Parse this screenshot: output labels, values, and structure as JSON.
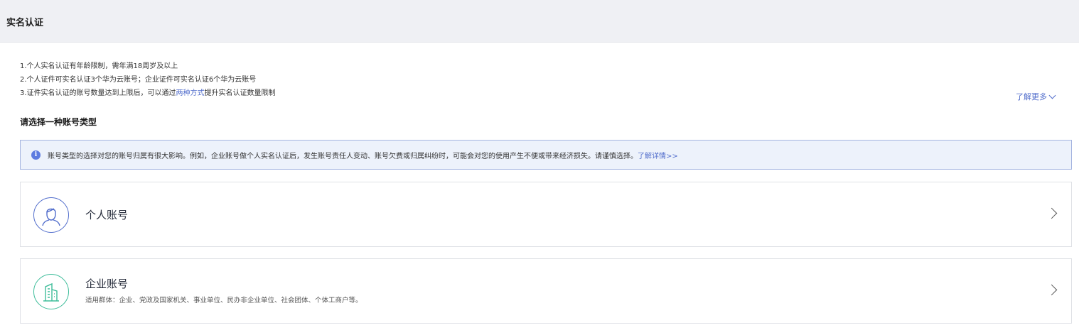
{
  "header": {
    "title": "实名认证"
  },
  "notes": {
    "line1": "1.个人实名认证有年龄限制，需年满18周岁及以上",
    "line2": "2.个人证件可实名认证3个华为云账号；企业证件可实名认证6个华为云账号",
    "line3_before": "3.证件实名认证的账号数量达到上限后，可以通过",
    "line3_link": "两种方式",
    "line3_after": "提升实名认证数量限制"
  },
  "learn_more": "了解更多",
  "section_title": "请选择一种账号类型",
  "alert": {
    "text": "账号类型的选择对您的账号归属有很大影响。例如，企业账号做个人实名认证后，发生账号责任人变动、账号欠费或归属纠纷时，可能会对您的使用产生不便或带来经济损失。请谨慎选择。",
    "link": "了解详情>>"
  },
  "cards": {
    "personal": {
      "title": "个人账号",
      "icon": "person-icon",
      "color": "#526ecc"
    },
    "enterprise": {
      "title": "企业账号",
      "description": "适用群体：企业、党政及国家机关、事业单位、民办非企业单位、社会团体、个体工商户等。",
      "icon": "building-icon",
      "color": "#3ebd9a"
    }
  },
  "colors": {
    "accent": "#526ecc",
    "alert_bg": "#edf2fb",
    "alert_border": "#a4b4e0",
    "enterprise": "#3ebd9a"
  }
}
